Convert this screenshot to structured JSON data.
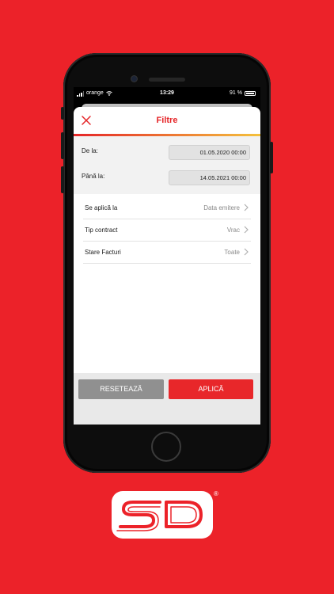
{
  "status_bar": {
    "carrier": "orange",
    "time": "13:29",
    "battery": "91 %"
  },
  "modal": {
    "title": "Filtre",
    "close_icon": "close-icon"
  },
  "date_filters": [
    {
      "label": "De la:",
      "value": "01.05.2020 00:00"
    },
    {
      "label": "Până la:",
      "value": "14.05.2021 00:00"
    }
  ],
  "options": [
    {
      "label": "Se aplică la",
      "value": "Data emitere"
    },
    {
      "label": "Tip contract",
      "value": "Vrac"
    },
    {
      "label": "Stare Facturi",
      "value": "Toate"
    }
  ],
  "actions": {
    "reset_label": "RESETEAZĂ",
    "apply_label": "APLICĂ"
  },
  "branding": {
    "logo_text": "SD",
    "registered_mark": "®"
  },
  "colors": {
    "background": "#ec2229",
    "accent_red": "#e52528",
    "accent_yellow": "#f4c13d",
    "reset_button": "#909090",
    "apply_button": "#e8272a"
  }
}
